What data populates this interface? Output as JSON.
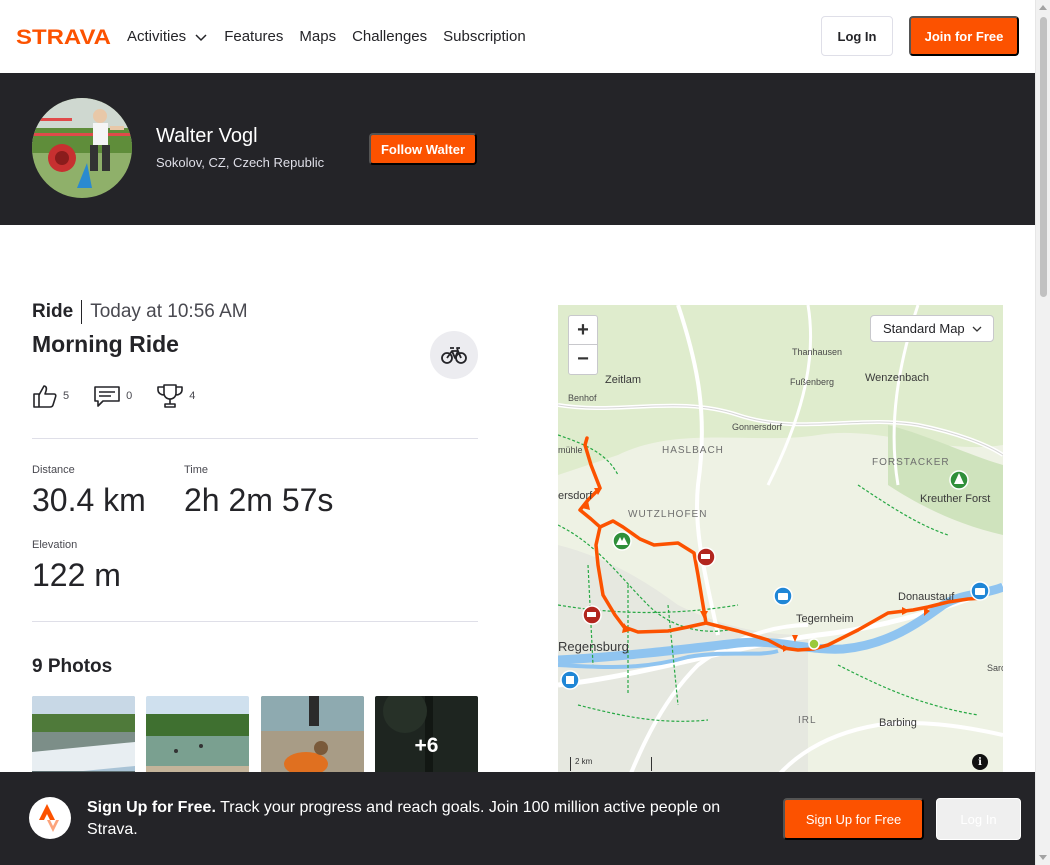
{
  "nav": {
    "brand": "STRAVA",
    "items": [
      "Activities",
      "Features",
      "Maps",
      "Challenges",
      "Subscription"
    ],
    "login": "Log In",
    "join": "Join for Free"
  },
  "athlete": {
    "name": "Walter Vogl",
    "location": "Sokolov, CZ, Czech Republic",
    "follow": "Follow Walter"
  },
  "activity": {
    "type": "Ride",
    "date": "Today at 10:56 AM",
    "title": "Morning Ride",
    "kudos": "5",
    "comments": "0",
    "achievements": "4",
    "stats": {
      "distance_label": "Distance",
      "distance": "30.4 km",
      "time_label": "Time",
      "time": "2h 2m 57s",
      "elevation_label": "Elevation",
      "elevation": "122 m"
    },
    "photos_title": "9 Photos",
    "more_photos": "+6"
  },
  "map": {
    "style": "Standard Map",
    "scale": "2 km",
    "info": "i",
    "labels": {
      "thanhausen": "Thanhausen",
      "fussenberg": "Fußenberg",
      "wenzenbach": "Wenzenbach",
      "zeitlam": "Zeitlam",
      "benhof": "Benhof",
      "gonnersdorf": "Gonnersdorf",
      "haslbach": "HASLBACH",
      "forstacker": "FORSTACKER",
      "kreuther_forst": "Kreuther Forst",
      "muhle": "mühle",
      "ersdorf": "ersdorf",
      "wutzlhofen": "WUTZLHOFEN",
      "donaustauf": "Donaustauf",
      "tegernheim": "Tegernheim",
      "regensburg": "Regensburg",
      "sar": "Sarc",
      "irl": "IRL",
      "barbing": "Barbing"
    },
    "colors": {
      "route": "#fc5200",
      "water": "#8fc4f0",
      "trail": "#27a844"
    }
  },
  "signup": {
    "headline": "Sign Up for Free.",
    "body": " Track your progress and reach goals. Join 100 million active people on Strava.",
    "signup_btn": "Sign Up for Free",
    "login_btn": "Log In"
  }
}
